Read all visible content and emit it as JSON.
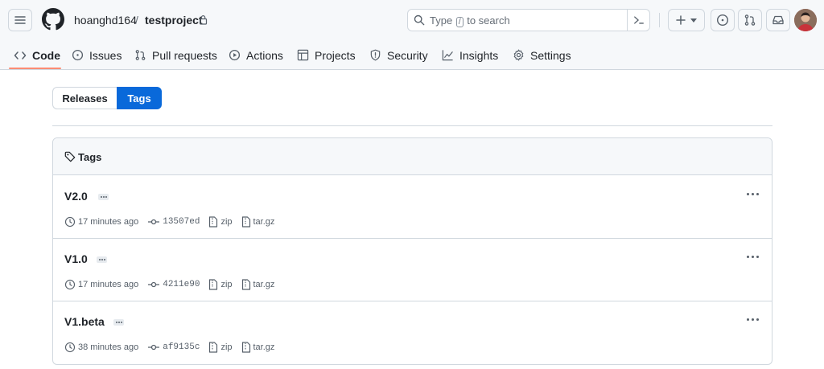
{
  "header": {
    "owner": "hoanghd164",
    "separator": "/",
    "repo": "testproject",
    "search": {
      "placeholder_before": "Type",
      "placeholder_key": "/",
      "placeholder_after": "to search"
    }
  },
  "nav": {
    "items": [
      {
        "label": "Code",
        "icon": "code-icon",
        "active": true
      },
      {
        "label": "Issues",
        "icon": "issue-opened-icon"
      },
      {
        "label": "Pull requests",
        "icon": "git-pull-request-icon"
      },
      {
        "label": "Actions",
        "icon": "play-icon"
      },
      {
        "label": "Projects",
        "icon": "table-icon"
      },
      {
        "label": "Security",
        "icon": "shield-icon"
      },
      {
        "label": "Insights",
        "icon": "graph-icon"
      },
      {
        "label": "Settings",
        "icon": "gear-icon"
      }
    ]
  },
  "subnav": {
    "releases_label": "Releases",
    "tags_label": "Tags",
    "selected": "Tags"
  },
  "tags_box": {
    "title": "Tags",
    "tags": [
      {
        "name": "V2.0",
        "time": "17 minutes ago",
        "sha": "13507ed",
        "zip": "zip",
        "targz": "tar.gz"
      },
      {
        "name": "V1.0",
        "time": "17 minutes ago",
        "sha": "4211e90",
        "zip": "zip",
        "targz": "tar.gz"
      },
      {
        "name": "V1.beta",
        "time": "38 minutes ago",
        "sha": "af9135c",
        "zip": "zip",
        "targz": "tar.gz"
      }
    ]
  },
  "colors": {
    "accent": "#0969da",
    "nav_underline": "#fd8c73",
    "border": "#d0d7de",
    "muted": "#57606a"
  }
}
